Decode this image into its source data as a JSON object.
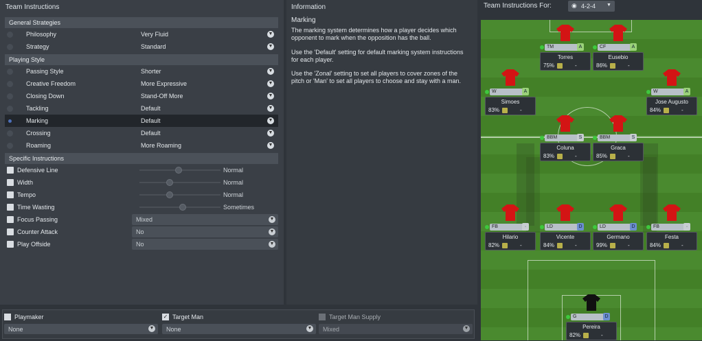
{
  "left_title": "Team Instructions",
  "general": {
    "title": "General Strategies",
    "rows": [
      {
        "label": "Philosophy",
        "value": "Very Fluid"
      },
      {
        "label": "Strategy",
        "value": "Standard"
      }
    ]
  },
  "playing": {
    "title": "Playing Style",
    "rows": [
      {
        "label": "Passing Style",
        "value": "Shorter"
      },
      {
        "label": "Creative Freedom",
        "value": "More Expressive"
      },
      {
        "label": "Closing Down",
        "value": "Stand-Off More"
      },
      {
        "label": "Tackling",
        "value": "Default"
      },
      {
        "label": "Marking",
        "value": "Default"
      },
      {
        "label": "Crossing",
        "value": "Default"
      },
      {
        "label": "Roaming",
        "value": "More Roaming"
      }
    ]
  },
  "specific": {
    "title": "Specific Instructions",
    "sliders": [
      {
        "label": "Defensive Line",
        "value": "Normal",
        "level": 0.48
      },
      {
        "label": "Width",
        "value": "Normal",
        "level": 0.37
      },
      {
        "label": "Tempo",
        "value": "Normal",
        "level": 0.37
      },
      {
        "label": "Time Wasting",
        "value": "Sometimes",
        "level": 0.53
      }
    ],
    "dropdowns": [
      {
        "label": "Focus Passing",
        "value": "Mixed"
      },
      {
        "label": "Counter Attack",
        "value": "No"
      },
      {
        "label": "Play Offside",
        "value": "No"
      }
    ]
  },
  "info": {
    "title": "Information",
    "heading": "Marking",
    "p1": "The marking system determines how a player decides which opponent to mark when the opposition has the ball.",
    "p2": "Use the 'Default' setting for default marking system instructions for each player.",
    "p3": "Use the 'Zonal' setting to set all players to cover zones of the pitch or 'Man' to set all players to choose and stay with a man."
  },
  "right": {
    "title": "Team Instructions For:",
    "formation": "4-2-4"
  },
  "players": [
    {
      "name": "Torres",
      "role": "TM",
      "duty": "A",
      "pct": "75%",
      "extra": "-"
    },
    {
      "name": "Eusebio",
      "role": "CF",
      "duty": "A",
      "pct": "86%",
      "extra": "-"
    },
    {
      "name": "Simoes",
      "role": "W",
      "duty": "A",
      "pct": "83%",
      "extra": "-"
    },
    {
      "name": "Jose Augusto",
      "role": "W",
      "duty": "A",
      "pct": "84%",
      "extra": "-"
    },
    {
      "name": "Coluna",
      "role": "BBM",
      "duty": "S",
      "pct": "83%",
      "extra": "-"
    },
    {
      "name": "Graca",
      "role": "BBM",
      "duty": "S",
      "pct": "85%",
      "extra": "-"
    },
    {
      "name": "Hilario",
      "role": "FB",
      "duty": "",
      "pct": "82%",
      "extra": "-"
    },
    {
      "name": "Vicente",
      "role": "LD",
      "duty": "D",
      "pct": "84%",
      "extra": "-"
    },
    {
      "name": "Germano",
      "role": "LD",
      "duty": "D",
      "pct": "99%",
      "extra": "-"
    },
    {
      "name": "Festa",
      "role": "FB",
      "duty": "",
      "pct": "84%",
      "extra": "-"
    },
    {
      "name": "Pereira",
      "role": "G",
      "duty": "D",
      "pct": "82%",
      "extra": "-"
    }
  ],
  "bottom": {
    "playmaker": {
      "label": "Playmaker",
      "value": "None"
    },
    "target_man": {
      "label": "Target Man",
      "value": "None"
    },
    "target_supply": {
      "label": "Target Man Supply",
      "value": "Mixed"
    }
  }
}
